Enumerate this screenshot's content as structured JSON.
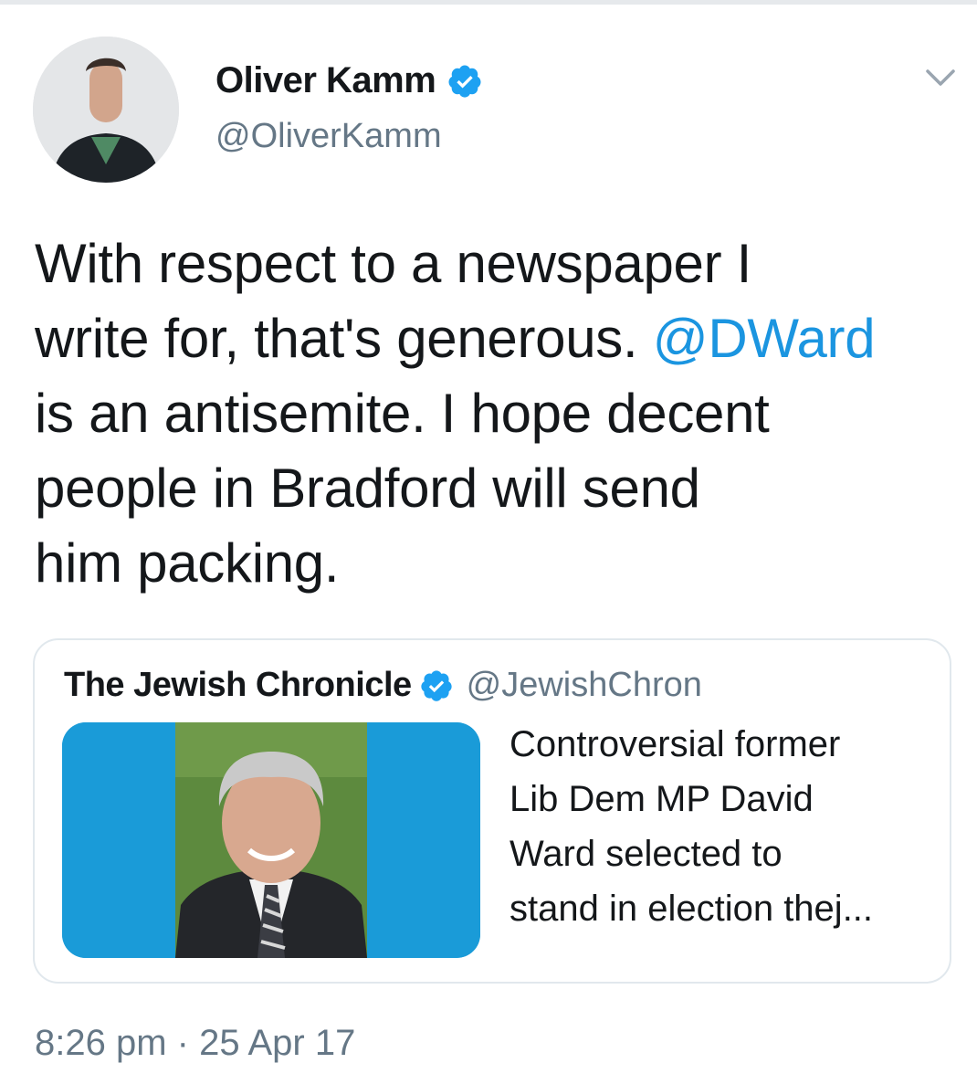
{
  "tweet": {
    "author": {
      "name": "Oliver Kamm",
      "handle": "@OliverKamm",
      "verified": true
    },
    "text_line_1": "With respect to a newspaper I",
    "text_line_2a": "write for, that's generous. ",
    "text_mention": "@DWard",
    "text_rest": "is an antisemite. I hope decent\npeople in Bradford will send\nhim packing.",
    "timestamp": "8:26 pm · 25 Apr 17"
  },
  "quoted": {
    "name": "The Jewish Chronicle",
    "handle": "@JewishChron",
    "verified": true,
    "text": "Controversial former\nLib Dem MP David\nWard selected to\nstand in election thej..."
  },
  "colors": {
    "link": "#1b95e0",
    "secondary_text": "#657786",
    "verified_badge": "#1da1f2",
    "quote_image_bg": "#1a9bd8"
  },
  "icons": {
    "menu": "chevron-down-icon",
    "verified": "verified-badge-icon"
  }
}
